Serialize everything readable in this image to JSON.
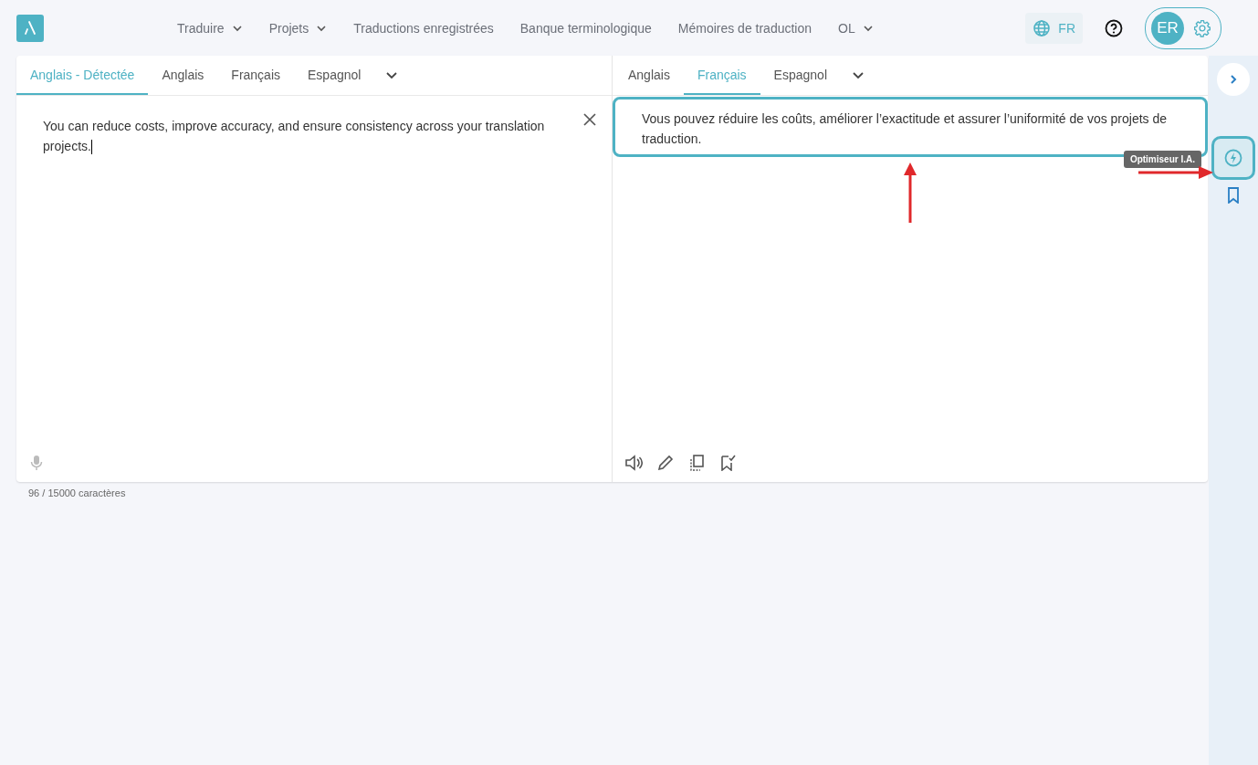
{
  "nav": [
    {
      "label": "Traduire",
      "dropdown": true
    },
    {
      "label": "Projets",
      "dropdown": true
    },
    {
      "label": "Traductions enregistrées",
      "dropdown": false
    },
    {
      "label": "Banque terminologique",
      "dropdown": false
    },
    {
      "label": "Mémoires de traduction",
      "dropdown": false
    },
    {
      "label": "OL",
      "dropdown": true
    }
  ],
  "language_button": {
    "label": "FR"
  },
  "user": {
    "initials": "ER"
  },
  "source": {
    "tabs": [
      {
        "label": "Anglais - Détectée",
        "selected": true
      },
      {
        "label": "Anglais",
        "selected": false
      },
      {
        "label": "Français",
        "selected": false
      },
      {
        "label": "Espagnol",
        "selected": false
      }
    ],
    "text": "You can reduce costs, improve accuracy, and ensure consistency across your translation projects.",
    "counter": "96 / 15000 caractères"
  },
  "target": {
    "tabs": [
      {
        "label": "Anglais",
        "selected": false
      },
      {
        "label": "Français",
        "selected": true
      },
      {
        "label": "Espagnol",
        "selected": false
      }
    ],
    "text": "Vous pouvez réduire les coûts, améliorer l’exactitude et assurer l’uniformité de vos projets de traduction.",
    "highlighted": true
  },
  "sidebar": {
    "optimizer_highlighted": true,
    "tooltip": "Optimiseur I.A."
  }
}
